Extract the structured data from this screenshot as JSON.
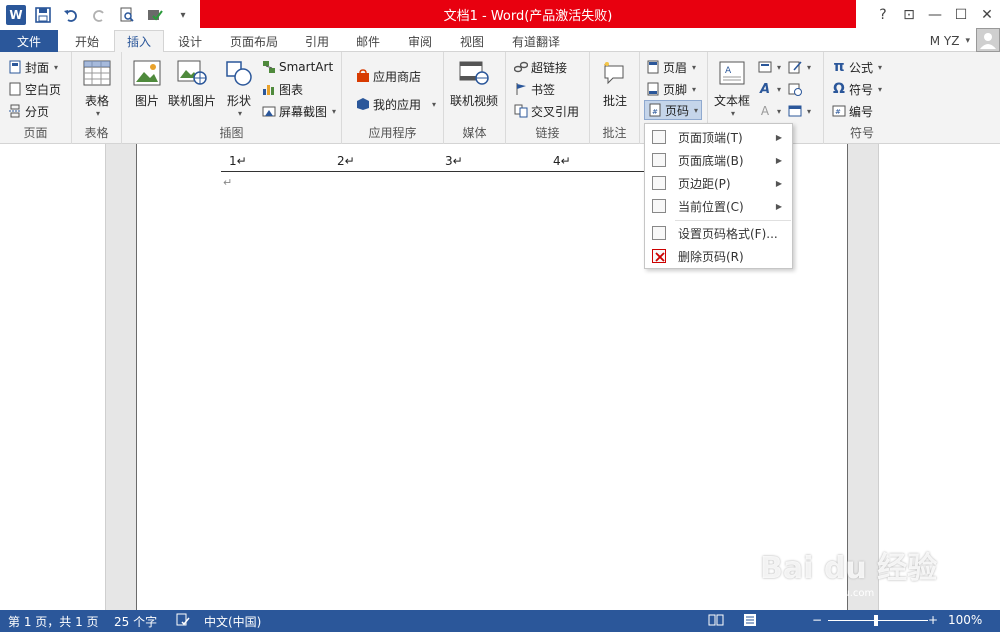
{
  "titlebar": {
    "title": "文档1 - Word(产品激活失败)",
    "qat": {
      "word": "W",
      "save": "save-icon",
      "undo": "undo-icon",
      "redo": "redo-icon",
      "preview": "print-preview-icon",
      "check": "check-icon",
      "more": "▾"
    },
    "controls": {
      "help": "?",
      "restore_ribbon": "⊡",
      "minimize": "—",
      "maximize": "☐",
      "close": "✕"
    }
  },
  "tabs": [
    {
      "label": "文件"
    },
    {
      "label": "开始"
    },
    {
      "label": "插入"
    },
    {
      "label": "设计"
    },
    {
      "label": "页面布局"
    },
    {
      "label": "引用"
    },
    {
      "label": "邮件"
    },
    {
      "label": "审阅"
    },
    {
      "label": "视图"
    },
    {
      "label": "有道翻译"
    }
  ],
  "user": {
    "name": "M YZ",
    "caret": "▾"
  },
  "ribbon": {
    "page": {
      "label": "页面",
      "cover": "封面",
      "blank": "空白页",
      "break": "分页"
    },
    "table": {
      "label": "表格",
      "btn": "表格"
    },
    "illustrations": {
      "label": "插图",
      "picture": "图片",
      "online_picture": "联机图片",
      "shapes": "形状",
      "smartart": "SmartArt",
      "chart": "图表",
      "screenshot": "屏幕截图"
    },
    "apps": {
      "label": "应用程序",
      "store": "应用商店",
      "myapps": "我的应用"
    },
    "media": {
      "label": "媒体",
      "online_video": "联机视频"
    },
    "links": {
      "label": "链接",
      "hyperlink": "超链接",
      "bookmark": "书签",
      "crossref": "交叉引用"
    },
    "comments": {
      "label": "批注",
      "comment": "批注"
    },
    "headerfooter": {
      "header": "页眉",
      "footer": "页脚",
      "pagenum": "页码"
    },
    "text": {
      "textbox": "文本框"
    },
    "symbols": {
      "label": "符号",
      "equation": "公式",
      "symbol": "符号",
      "number": "编号"
    }
  },
  "document": {
    "numbers": [
      "1↵",
      "2↵",
      "3↵",
      "4↵"
    ],
    "cursor_mark": "↵"
  },
  "menu": {
    "items": [
      {
        "label": "页面顶端(T)",
        "has_sub": true
      },
      {
        "label": "页面底端(B)",
        "has_sub": true
      },
      {
        "label": "页边距(P)",
        "has_sub": true
      },
      {
        "label": "当前位置(C)",
        "has_sub": true
      },
      {
        "label": "设置页码格式(F)...",
        "has_sub": false
      },
      {
        "label": "删除页码(R)",
        "has_sub": false
      }
    ],
    "arrow": "▶"
  },
  "statusbar": {
    "page": "第 1 页，共 1 页",
    "words": "25 个字",
    "lang": "中文(中国)",
    "zoom": "100%",
    "zoom_minus": "−",
    "zoom_plus": "+"
  },
  "watermark": {
    "text": "Bai du 经验",
    "url": "jingyan.baidu.com"
  },
  "colors": {
    "accent": "#2b579a",
    "title_red": "#e8000f"
  }
}
